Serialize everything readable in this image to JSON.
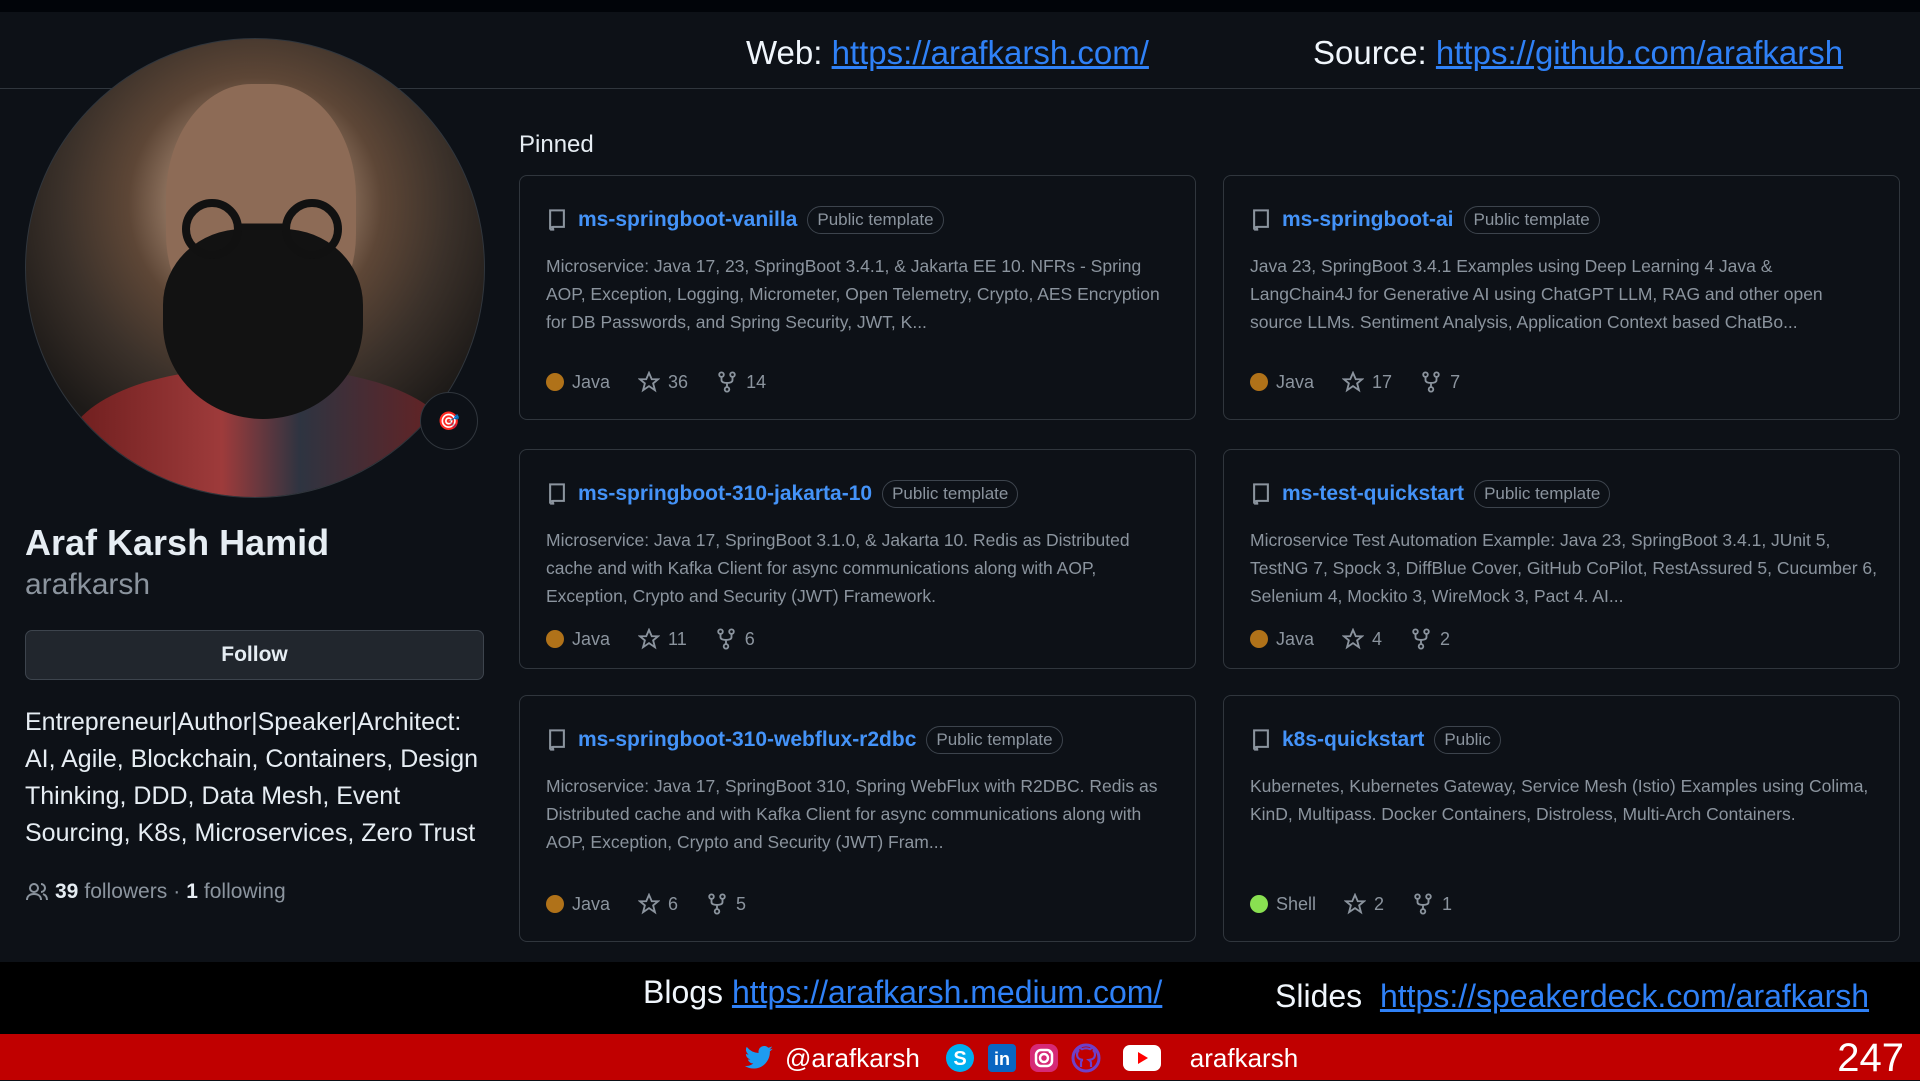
{
  "header": {
    "web_label": "Web:",
    "web_url": "https://arafkarsh.com/",
    "source_label": "Source:",
    "source_url": "https://github.com/arafkarsh"
  },
  "profile": {
    "name": "Araf Karsh Hamid",
    "login": "arafkarsh",
    "follow_label": "Follow",
    "bio": "Entrepreneur|Author|Speaker|Architect: AI, Agile, Blockchain, Containers, Design Thinking, DDD, Data Mesh, Event Sourcing, K8s, Microservices, Zero Trust",
    "followers_count": "39",
    "followers_label": "followers",
    "separator": "·",
    "following_count": "1",
    "following_label": "following"
  },
  "pinned": {
    "title": "Pinned",
    "repos": [
      {
        "name": "ms-springboot-vanilla",
        "badge": "Public template",
        "description": "Microservice: Java 17, 23, SpringBoot 3.4.1, & Jakarta EE 10. NFRs - Spring AOP, Exception, Logging, Micrometer, Open Telemetry, Crypto, AES Encryption for DB Passwords, and Spring Security, JWT, K...",
        "language": "Java",
        "language_color": "#b07219",
        "stars": "36",
        "forks": "14"
      },
      {
        "name": "ms-springboot-ai",
        "badge": "Public template",
        "description": "Java 23, SpringBoot 3.4.1 Examples using Deep Learning 4 Java & LangChain4J for Generative AI using ChatGPT LLM, RAG and other open source LLMs. Sentiment Analysis, Application Context based ChatBo...",
        "language": "Java",
        "language_color": "#b07219",
        "stars": "17",
        "forks": "7"
      },
      {
        "name": "ms-springboot-310-jakarta-10",
        "badge": "Public template",
        "description": "Microservice: Java 17, SpringBoot 3.1.0, & Jakarta 10. Redis as Distributed cache and with Kafka Client for async communications along with AOP, Exception, Crypto and Security (JWT) Framework.",
        "language": "Java",
        "language_color": "#b07219",
        "stars": "11",
        "forks": "6"
      },
      {
        "name": "ms-test-quickstart",
        "badge": "Public template",
        "description": "Microservice Test Automation Example: Java 23, SpringBoot 3.4.1, JUnit 5, TestNG 7, Spock 3, DiffBlue Cover, GitHub CoPilot, RestAssured 5, Cucumber 6, Selenium 4, Mockito 3, WireMock 3, Pact 4. AI...",
        "language": "Java",
        "language_color": "#b07219",
        "stars": "4",
        "forks": "2"
      },
      {
        "name": "ms-springboot-310-webflux-r2dbc",
        "badge": "Public template",
        "description": "Microservice: Java 17, SpringBoot 310, Spring WebFlux with R2DBC. Redis as Distributed cache and with Kafka Client for async communications along with AOP, Exception, Crypto and Security (JWT) Fram...",
        "language": "Java",
        "language_color": "#b07219",
        "stars": "6",
        "forks": "5"
      },
      {
        "name": "k8s-quickstart",
        "badge": "Public",
        "description": "Kubernetes, Kubernetes Gateway, Service Mesh (Istio) Examples using Colima, KinD, Multipass. Docker Containers, Distroless, Multi-Arch Containers.",
        "language": "Shell",
        "language_color": "#89e051",
        "stars": "2",
        "forks": "1"
      }
    ]
  },
  "bottom": {
    "blogs_label": "Blogs",
    "blogs_url": "https://arafkarsh.medium.com/",
    "slides_label": "Slides",
    "slides_url": "https://speakerdeck.com/arafkarsh"
  },
  "footer": {
    "twitter_handle": "@arafkarsh",
    "social_handle": "arafkarsh",
    "page_number": "247",
    "icons": [
      "twitter-icon",
      "skype-icon",
      "linkedin-icon",
      "instagram-icon",
      "github-icon",
      "youtube-icon"
    ]
  }
}
